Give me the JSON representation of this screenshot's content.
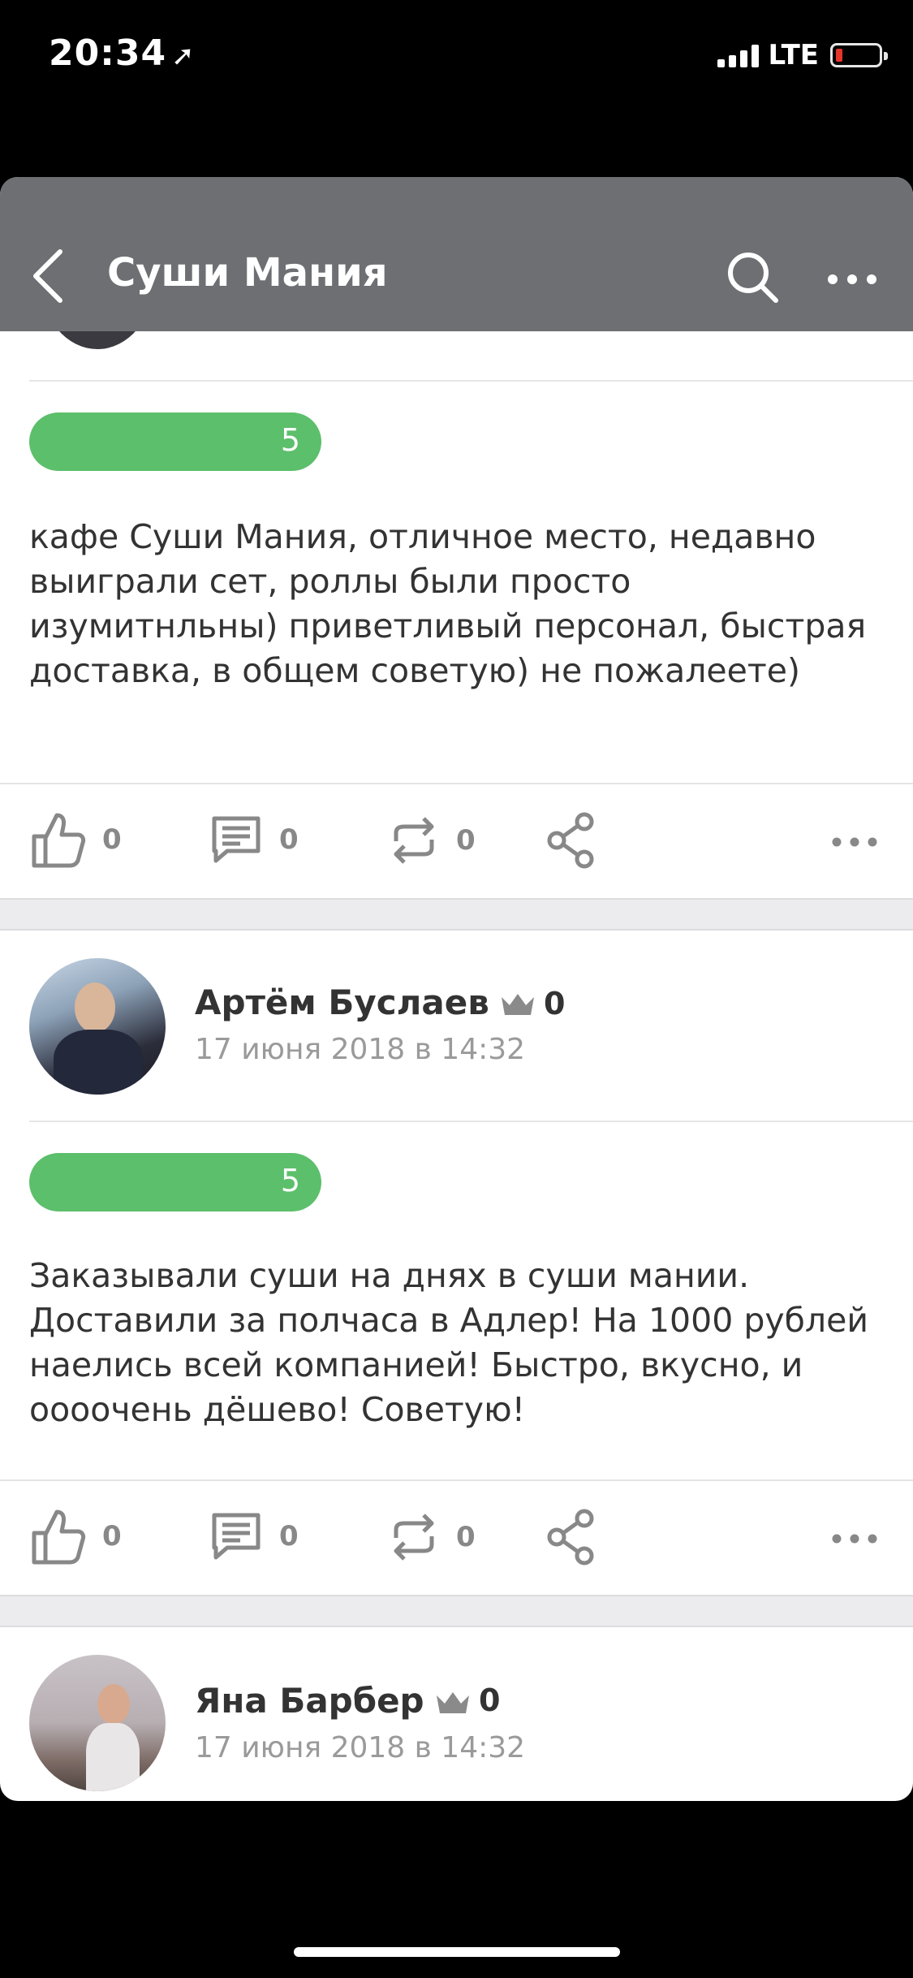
{
  "status_bar": {
    "time": "20:34",
    "network": "LTE"
  },
  "header": {
    "title": "Суши Мания"
  },
  "reviews": [
    {
      "rating": "5",
      "text": "кафе Суши Мания, отличное место, недавно выиграли сет, роллы были просто изумитнльны) приветливый персонал, быстрая доставка, в общем советую) не пожалеете)",
      "likes": "0",
      "comments": "0",
      "reposts": "0"
    },
    {
      "author": "Артём Буслаев",
      "karma": "0",
      "date": "17 июня 2018 в 14:32",
      "rating": "5",
      "text": "Заказывали суши на днях в суши мании. Доставили за полчаса в Адлер! На 1000 рублей наелись всей компанией! Быстро, вкусно, и оооочень дёшево! Советую!",
      "likes": "0",
      "comments": "0",
      "reposts": "0"
    },
    {
      "author": "Яна Барбер",
      "karma": "0",
      "date": "17 июня 2018 в 14:32"
    }
  ],
  "icons": {
    "back": "chevron-left-icon",
    "search": "search-icon",
    "more": "more-horizontal-icon",
    "like": "thumbs-up-icon",
    "comment": "comment-icon",
    "repost": "repost-icon",
    "share": "share-icon",
    "crown": "crown-icon"
  },
  "colors": {
    "rating": "#5cbf6b",
    "header": "#6d6f73",
    "battery_low": "#ff3b30"
  }
}
